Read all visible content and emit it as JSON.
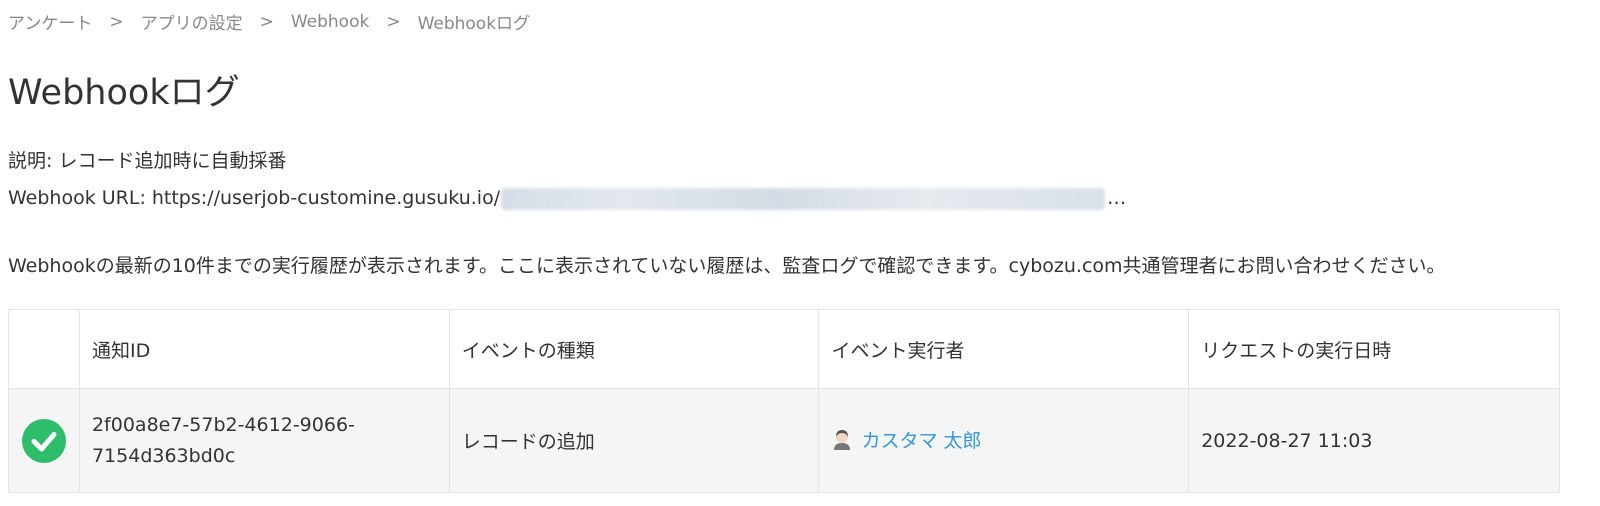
{
  "breadcrumb": {
    "items": [
      "アンケート",
      "アプリの設定",
      "Webhook",
      "Webhookログ"
    ],
    "separator": ">"
  },
  "page_title": "Webhookログ",
  "description": "説明: レコード追加時に自動採番",
  "webhook_url": {
    "label": "Webhook URL:",
    "visible_part": "https://userjob-customine.gusuku.io/",
    "ellipsis": "…"
  },
  "notice": "Webhookの最新の10件までの実行履歴が表示されます。ここに表示されていない履歴は、監査ログで確認できます。cybozu.com共通管理者にお問い合わせください。",
  "table": {
    "headers": [
      "",
      "通知ID",
      "イベントの種類",
      "イベント実行者",
      "リクエストの実行日時"
    ],
    "rows": [
      {
        "status_icon": "success-check-icon",
        "notification_id": "2f00a8e7-57b2-4612-9066-\n7154d363bd0c",
        "event_type": "レコードの追加",
        "user": "カスタマ 太郎",
        "datetime": "2022-08-27 11:03"
      }
    ]
  },
  "colors": {
    "success": "#2ebd6b",
    "link": "#3498db",
    "row_bg": "#f5f5f5"
  }
}
